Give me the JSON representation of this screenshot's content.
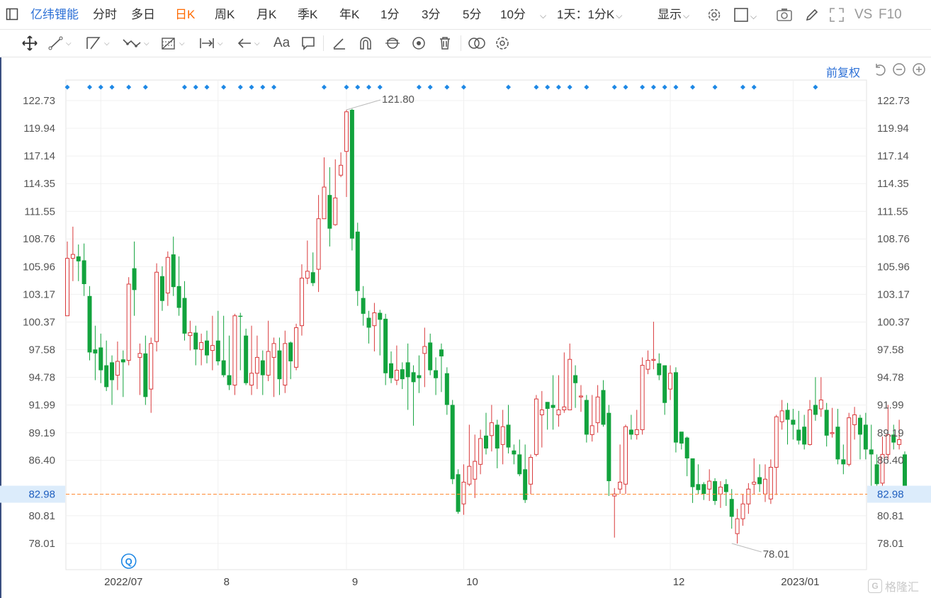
{
  "topbar": {
    "stock_name": "亿纬锂能",
    "periods": [
      "分时",
      "多日",
      "日K",
      "周K",
      "月K",
      "季K",
      "年K",
      "1分",
      "3分",
      "5分",
      "10分"
    ],
    "active_period": "日K",
    "multi_period_label": "1天：1分K",
    "display_label": "显示",
    "vs_label": "VS",
    "f10_label": "F10"
  },
  "toolbar_icons": [
    "move-icon",
    "line-icon",
    "polyline-icon",
    "wave-icon",
    "fib-icon",
    "measure-icon",
    "arrow-icon",
    "text-icon",
    "note-icon",
    "pen-icon",
    "magnet-icon",
    "sync-icon",
    "eye-icon",
    "trash-icon",
    "compare-icon",
    "settings-icon"
  ],
  "toolbar_text_label": "Aa",
  "adjust_label": "前复权",
  "watermark": "格隆汇",
  "colors": {
    "up": "#d9383a",
    "down": "#12a33d",
    "accent": "#2b6fd6",
    "active_tab": "#ff6a00",
    "current_line": "#ff8a33"
  },
  "chart_data": {
    "type": "candlestick",
    "y_ticks": [
      "122.73",
      "119.94",
      "117.14",
      "114.35",
      "111.55",
      "108.76",
      "105.96",
      "103.17",
      "100.37",
      "97.58",
      "94.78",
      "91.99",
      "89.19",
      "86.40",
      "80.81",
      "78.01"
    ],
    "ylim": [
      76.5,
      124.2
    ],
    "x_labels": [
      {
        "label": "2022/07",
        "index": 6
      },
      {
        "label": "8",
        "index": 27
      },
      {
        "label": "9",
        "index": 50
      },
      {
        "label": "10",
        "index": 71
      },
      {
        "label": "12",
        "index": 108
      },
      {
        "label": "2023/01",
        "index": 130
      }
    ],
    "current_price": "82.98",
    "max_label": "121.80",
    "min_label": "78.01",
    "event_marker": "Q",
    "event_marker_index": 11,
    "dot_indices": [
      0,
      4,
      6,
      8,
      11,
      14,
      21,
      23,
      25,
      28,
      31,
      33,
      35,
      37,
      46,
      50,
      52,
      54,
      56,
      63,
      65,
      68,
      71,
      79,
      84,
      86,
      88,
      90,
      93,
      98,
      100,
      103,
      105,
      107,
      109,
      112,
      116,
      121,
      123,
      134
    ],
    "candles": [
      [
        101.0,
        106.8,
        108.5,
        101.0
      ],
      [
        106.8,
        107.2,
        110.0,
        104.5
      ],
      [
        107.0,
        106.5,
        108.2,
        104.5
      ],
      [
        106.6,
        104.2,
        108.3,
        103.0
      ],
      [
        103.0,
        97.3,
        104.0,
        96.5
      ],
      [
        97.6,
        97.2,
        100.0,
        94.5
      ],
      [
        97.8,
        95.5,
        99.2,
        94.2
      ],
      [
        96.0,
        93.8,
        98.5,
        93.4
      ],
      [
        96.3,
        94.5,
        97.0,
        92.0
      ],
      [
        95.0,
        96.4,
        98.4,
        93.5
      ],
      [
        96.6,
        96.3,
        97.5,
        92.8
      ],
      [
        96.5,
        104.2,
        104.9,
        96.0
      ],
      [
        105.8,
        103.6,
        108.5,
        101.0
      ],
      [
        96.8,
        97.2,
        98.2,
        93.0
      ],
      [
        97.2,
        92.8,
        99.0,
        92.0
      ],
      [
        93.6,
        98.2,
        98.8,
        91.2
      ],
      [
        98.4,
        105.4,
        106.3,
        97.4
      ],
      [
        105.0,
        102.5,
        106.0,
        101.5
      ],
      [
        103.3,
        106.9,
        107.5,
        102.0
      ],
      [
        107.2,
        103.9,
        109.0,
        103.0
      ],
      [
        104.0,
        101.8,
        107.0,
        101.0
      ],
      [
        102.8,
        99.2,
        104.5,
        98.5
      ],
      [
        99.0,
        99.3,
        100.5,
        97.5
      ],
      [
        99.3,
        97.6,
        100.0,
        96.0
      ],
      [
        97.6,
        98.3,
        99.2,
        96.0
      ],
      [
        98.5,
        97.0,
        99.5,
        96.2
      ],
      [
        97.5,
        98.0,
        101.0,
        95.5
      ],
      [
        98.5,
        96.4,
        101.5,
        96.0
      ],
      [
        96.5,
        95.0,
        101.0,
        94.8
      ],
      [
        95.0,
        94.0,
        99.0,
        93.5
      ],
      [
        94.0,
        101.0,
        101.2,
        93.0
      ],
      [
        101.0,
        100.9,
        101.3,
        95.5
      ],
      [
        99.0,
        94.2,
        99.7,
        94.0
      ],
      [
        94.0,
        95.2,
        100.0,
        93.0
      ],
      [
        95.2,
        96.8,
        99.0,
        93.6
      ],
      [
        96.5,
        95.0,
        97.5,
        93.0
      ],
      [
        95.0,
        97.4,
        100.5,
        94.4
      ],
      [
        96.8,
        98.2,
        98.8,
        92.8
      ],
      [
        97.5,
        94.6,
        98.8,
        93.0
      ],
      [
        94.0,
        98.2,
        99.5,
        93.2
      ],
      [
        98.3,
        96.4,
        98.4,
        94.6
      ],
      [
        95.8,
        99.8,
        100.2,
        95.5
      ],
      [
        100.0,
        104.8,
        106.2,
        99.0
      ],
      [
        104.8,
        105.5,
        108.6,
        104.2
      ],
      [
        105.4,
        104.3,
        107.4,
        104.0
      ],
      [
        105.7,
        110.8,
        113.2,
        103.4
      ],
      [
        110.8,
        114.0,
        117.0,
        110.8
      ],
      [
        113.2,
        109.8,
        116.0,
        108.0
      ],
      [
        110.2,
        112.9,
        116.8,
        110.1
      ],
      [
        115.2,
        116.2,
        117.5,
        115.0
      ],
      [
        117.6,
        121.6,
        121.8,
        113.0
      ],
      [
        121.8,
        108.8,
        121.9,
        107.6
      ],
      [
        109.5,
        103.5,
        110.4,
        102.0
      ],
      [
        102.8,
        101.2,
        104.0,
        100.0
      ],
      [
        100.8,
        99.8,
        101.5,
        98.2
      ],
      [
        100.0,
        101.3,
        102.3,
        97.4
      ],
      [
        101.3,
        100.6,
        101.6,
        97.0
      ],
      [
        100.7,
        95.2,
        101.2,
        94.0
      ],
      [
        96.2,
        94.7,
        97.4,
        94.2
      ],
      [
        94.5,
        95.5,
        98.0,
        94.0
      ],
      [
        95.6,
        94.6,
        96.3,
        93.6
      ],
      [
        96.3,
        94.8,
        98.2,
        91.5
      ],
      [
        95.3,
        94.3,
        96.0,
        89.9
      ],
      [
        95.0,
        94.7,
        97.0,
        93.2
      ],
      [
        97.2,
        97.9,
        99.8,
        93.8
      ],
      [
        98.3,
        95.5,
        99.2,
        95.0
      ],
      [
        95.5,
        94.7,
        96.8,
        93.0
      ],
      [
        97.6,
        96.9,
        98.2,
        93.3
      ],
      [
        95.2,
        92.0,
        95.8,
        91.0
      ],
      [
        92.0,
        84.5,
        92.5,
        84.0
      ],
      [
        85.0,
        81.2,
        85.5,
        81.0
      ],
      [
        82.0,
        84.2,
        86.0,
        80.9
      ],
      [
        84.0,
        85.8,
        90.0,
        83.8
      ],
      [
        84.5,
        86.3,
        89.0,
        82.6
      ],
      [
        86.0,
        88.6,
        89.5,
        85.0
      ],
      [
        88.9,
        87.6,
        91.2,
        87.0
      ],
      [
        88.9,
        90.2,
        92.0,
        87.3
      ],
      [
        90.0,
        87.6,
        90.5,
        85.6
      ],
      [
        88.0,
        89.8,
        91.5,
        86.0
      ],
      [
        90.0,
        87.7,
        92.0,
        87.1
      ],
      [
        87.4,
        87.0,
        88.0,
        86.0
      ],
      [
        87.0,
        85.0,
        88.5,
        84.8
      ],
      [
        85.5,
        82.4,
        88.0,
        82.1
      ],
      [
        84.0,
        86.7,
        87.0,
        83.0
      ],
      [
        87.0,
        92.6,
        93.0,
        86.8
      ],
      [
        91.0,
        91.5,
        93.4,
        87.7
      ],
      [
        92.3,
        91.6,
        92.3,
        89.5
      ],
      [
        92.0,
        91.7,
        95.0,
        89.5
      ],
      [
        91.0,
        91.5,
        95.0,
        89.8
      ],
      [
        91.5,
        91.8,
        97.3,
        91.2
      ],
      [
        91.5,
        96.6,
        98.2,
        91.5
      ],
      [
        95.0,
        94.2,
        96.0,
        91.7
      ],
      [
        92.8,
        92.9,
        94.0,
        91.3
      ],
      [
        92.5,
        89.0,
        93.0,
        88.2
      ],
      [
        89.0,
        89.9,
        93.0,
        88.3
      ],
      [
        90.2,
        92.8,
        94.0,
        89.2
      ],
      [
        93.5,
        90.0,
        94.5,
        89.8
      ],
      [
        91.2,
        84.3,
        92.0,
        82.8
      ],
      [
        82.8,
        83.0,
        83.6,
        78.6
      ],
      [
        83.5,
        84.2,
        88.0,
        83.0
      ],
      [
        84.0,
        89.8,
        90.0,
        83.0
      ],
      [
        89.5,
        89.0,
        91.0,
        88.5
      ],
      [
        89.0,
        89.5,
        91.5,
        88.5
      ],
      [
        89.5,
        96.0,
        96.8,
        89.0
      ],
      [
        95.6,
        96.5,
        97.5,
        95.1
      ],
      [
        96.5,
        96.6,
        100.4,
        95.6
      ],
      [
        96.2,
        95.0,
        97.2,
        94.5
      ],
      [
        96.0,
        92.2,
        96.0,
        91.0
      ],
      [
        93.6,
        95.2,
        96.0,
        92.5
      ],
      [
        95.3,
        88.2,
        95.8,
        87.2
      ],
      [
        89.3,
        88.1,
        89.2,
        87.5
      ],
      [
        88.7,
        86.6,
        88.8,
        84.8
      ],
      [
        86.6,
        83.7,
        86.6,
        82.1
      ],
      [
        84.0,
        83.4,
        86.0,
        83.0
      ],
      [
        84.0,
        83.0,
        84.2,
        82.4
      ],
      [
        83.5,
        84.3,
        85.5,
        82.3
      ],
      [
        84.3,
        82.3,
        84.6,
        81.9
      ],
      [
        83.0,
        83.7,
        84.3,
        81.6
      ],
      [
        84.0,
        83.2,
        84.5,
        81.8
      ],
      [
        82.5,
        80.7,
        83.5,
        79.5
      ],
      [
        79.0,
        80.5,
        81.5,
        78.0
      ],
      [
        80.5,
        82.0,
        83.0,
        79.8
      ],
      [
        82.0,
        83.5,
        84.1,
        81.0
      ],
      [
        84.0,
        84.2,
        86.6,
        83.0
      ],
      [
        84.7,
        84.0,
        86.0,
        83.2
      ],
      [
        83.0,
        84.5,
        86.0,
        82.2
      ],
      [
        82.5,
        85.7,
        86.5,
        82.0
      ],
      [
        85.7,
        90.8,
        91.0,
        82.9
      ],
      [
        90.3,
        91.4,
        92.5,
        89.5
      ],
      [
        91.5,
        90.5,
        92.2,
        88.0
      ],
      [
        90.5,
        90.0,
        91.6,
        88.5
      ],
      [
        89.5,
        88.4,
        91.4,
        88.0
      ],
      [
        89.8,
        88.0,
        91.0,
        87.5
      ],
      [
        88.0,
        91.5,
        92.5,
        87.9
      ],
      [
        92.0,
        91.0,
        94.8,
        90.4
      ],
      [
        91.6,
        92.5,
        94.8,
        90.8
      ],
      [
        91.5,
        88.9,
        92.2,
        87.8
      ],
      [
        89.1,
        89.2,
        91.7,
        88.7
      ],
      [
        89.8,
        86.5,
        91.6,
        86.0
      ],
      [
        86.5,
        86.0,
        88.0,
        85.0
      ],
      [
        86.0,
        90.7,
        91.2,
        85.8
      ],
      [
        90.0,
        91.0,
        91.8,
        88.5
      ],
      [
        90.7,
        89.0,
        91.0,
        86.5
      ],
      [
        90.0,
        87.5,
        91.2,
        86.5
      ],
      [
        87.5,
        87.0,
        90.0,
        82.8
      ],
      [
        86.0,
        84.0,
        87.0,
        83.4
      ],
      [
        84.1,
        87.0,
        88.8,
        82.5
      ],
      [
        87.0,
        89.0,
        92.0,
        86.5
      ],
      [
        89.0,
        88.2,
        90.0,
        87.5
      ],
      [
        88.0,
        88.5,
        90.5,
        87.5
      ],
      [
        87.0,
        83.0,
        87.3,
        83.0
      ]
    ]
  }
}
